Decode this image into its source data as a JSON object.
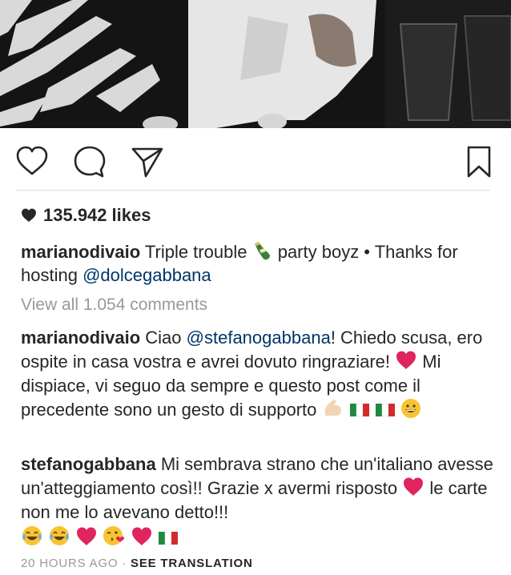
{
  "post": {
    "likes_count": "135.942",
    "likes_label": "likes"
  },
  "caption": {
    "username": "marianodivaio",
    "text_1": "Triple trouble",
    "text_2": "party boyz • Thanks for hosting",
    "mention": "@dolcegabbana"
  },
  "comments": {
    "view_all_label": "View all 1.054 comments",
    "items": [
      {
        "username": "marianodivaio",
        "text_1": "Ciao",
        "mention": "@stefanogabbana",
        "text_2": "! Chiedo scusa, ero ospite in casa vostra e avrei dovuto ringraziare!",
        "text_3": "Mi dispiace, vi seguo da sempre e questo post come il precedente sono un gesto di supporto"
      },
      {
        "username": "stefanogabbana",
        "text_1": "Mi sembrava strano che un'italiano avesse un'atteggiamento così!! Grazie x avermi risposto",
        "text_2": "le carte non me lo avevano detto!!!"
      }
    ]
  },
  "meta": {
    "timestamp": "20 HOURS AGO",
    "separator": "·",
    "translate_label": "SEE TRANSLATION"
  },
  "icons": {
    "like": "heart-outline-icon",
    "comment": "speech-bubble-icon",
    "share": "paper-plane-icon",
    "save": "bookmark-icon"
  },
  "colors": {
    "text": "#262626",
    "muted": "#999999",
    "mention": "#003569",
    "emoji_red": "#e0245e"
  }
}
